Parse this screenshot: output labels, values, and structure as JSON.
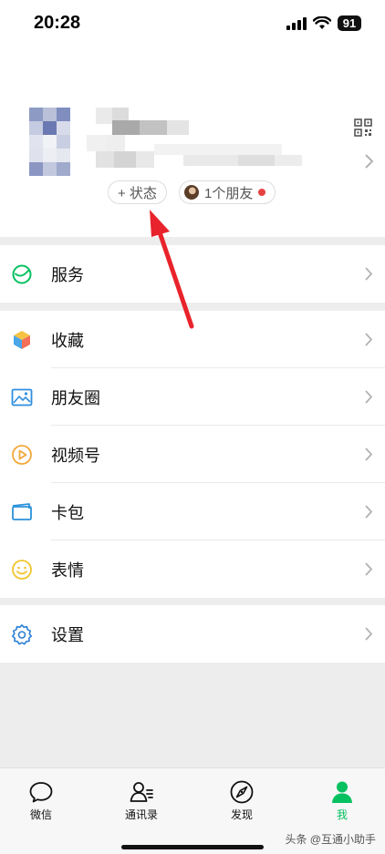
{
  "status_bar": {
    "time": "20:28",
    "battery": "91"
  },
  "profile": {
    "status_button": "+ 状态",
    "friends_pill": "1个朋友"
  },
  "menu": {
    "services": "服务",
    "favorites": "收藏",
    "moments": "朋友圈",
    "channels": "视频号",
    "cards": "卡包",
    "stickers": "表情",
    "settings": "设置"
  },
  "tabbar": {
    "chats": "微信",
    "contacts": "通讯录",
    "discover": "发现",
    "me": "我"
  },
  "watermark": "头条 @互通小助手",
  "colors": {
    "accent": "#07c160",
    "arrow": "#e8232b",
    "badge": "#e64340"
  },
  "icons": [
    "qr-code-icon",
    "chevron-right-icon",
    "services-icon",
    "favorites-icon",
    "moments-icon",
    "channels-icon",
    "cards-icon",
    "stickers-icon",
    "settings-icon",
    "chats-icon",
    "contacts-icon",
    "discover-icon",
    "me-icon"
  ]
}
